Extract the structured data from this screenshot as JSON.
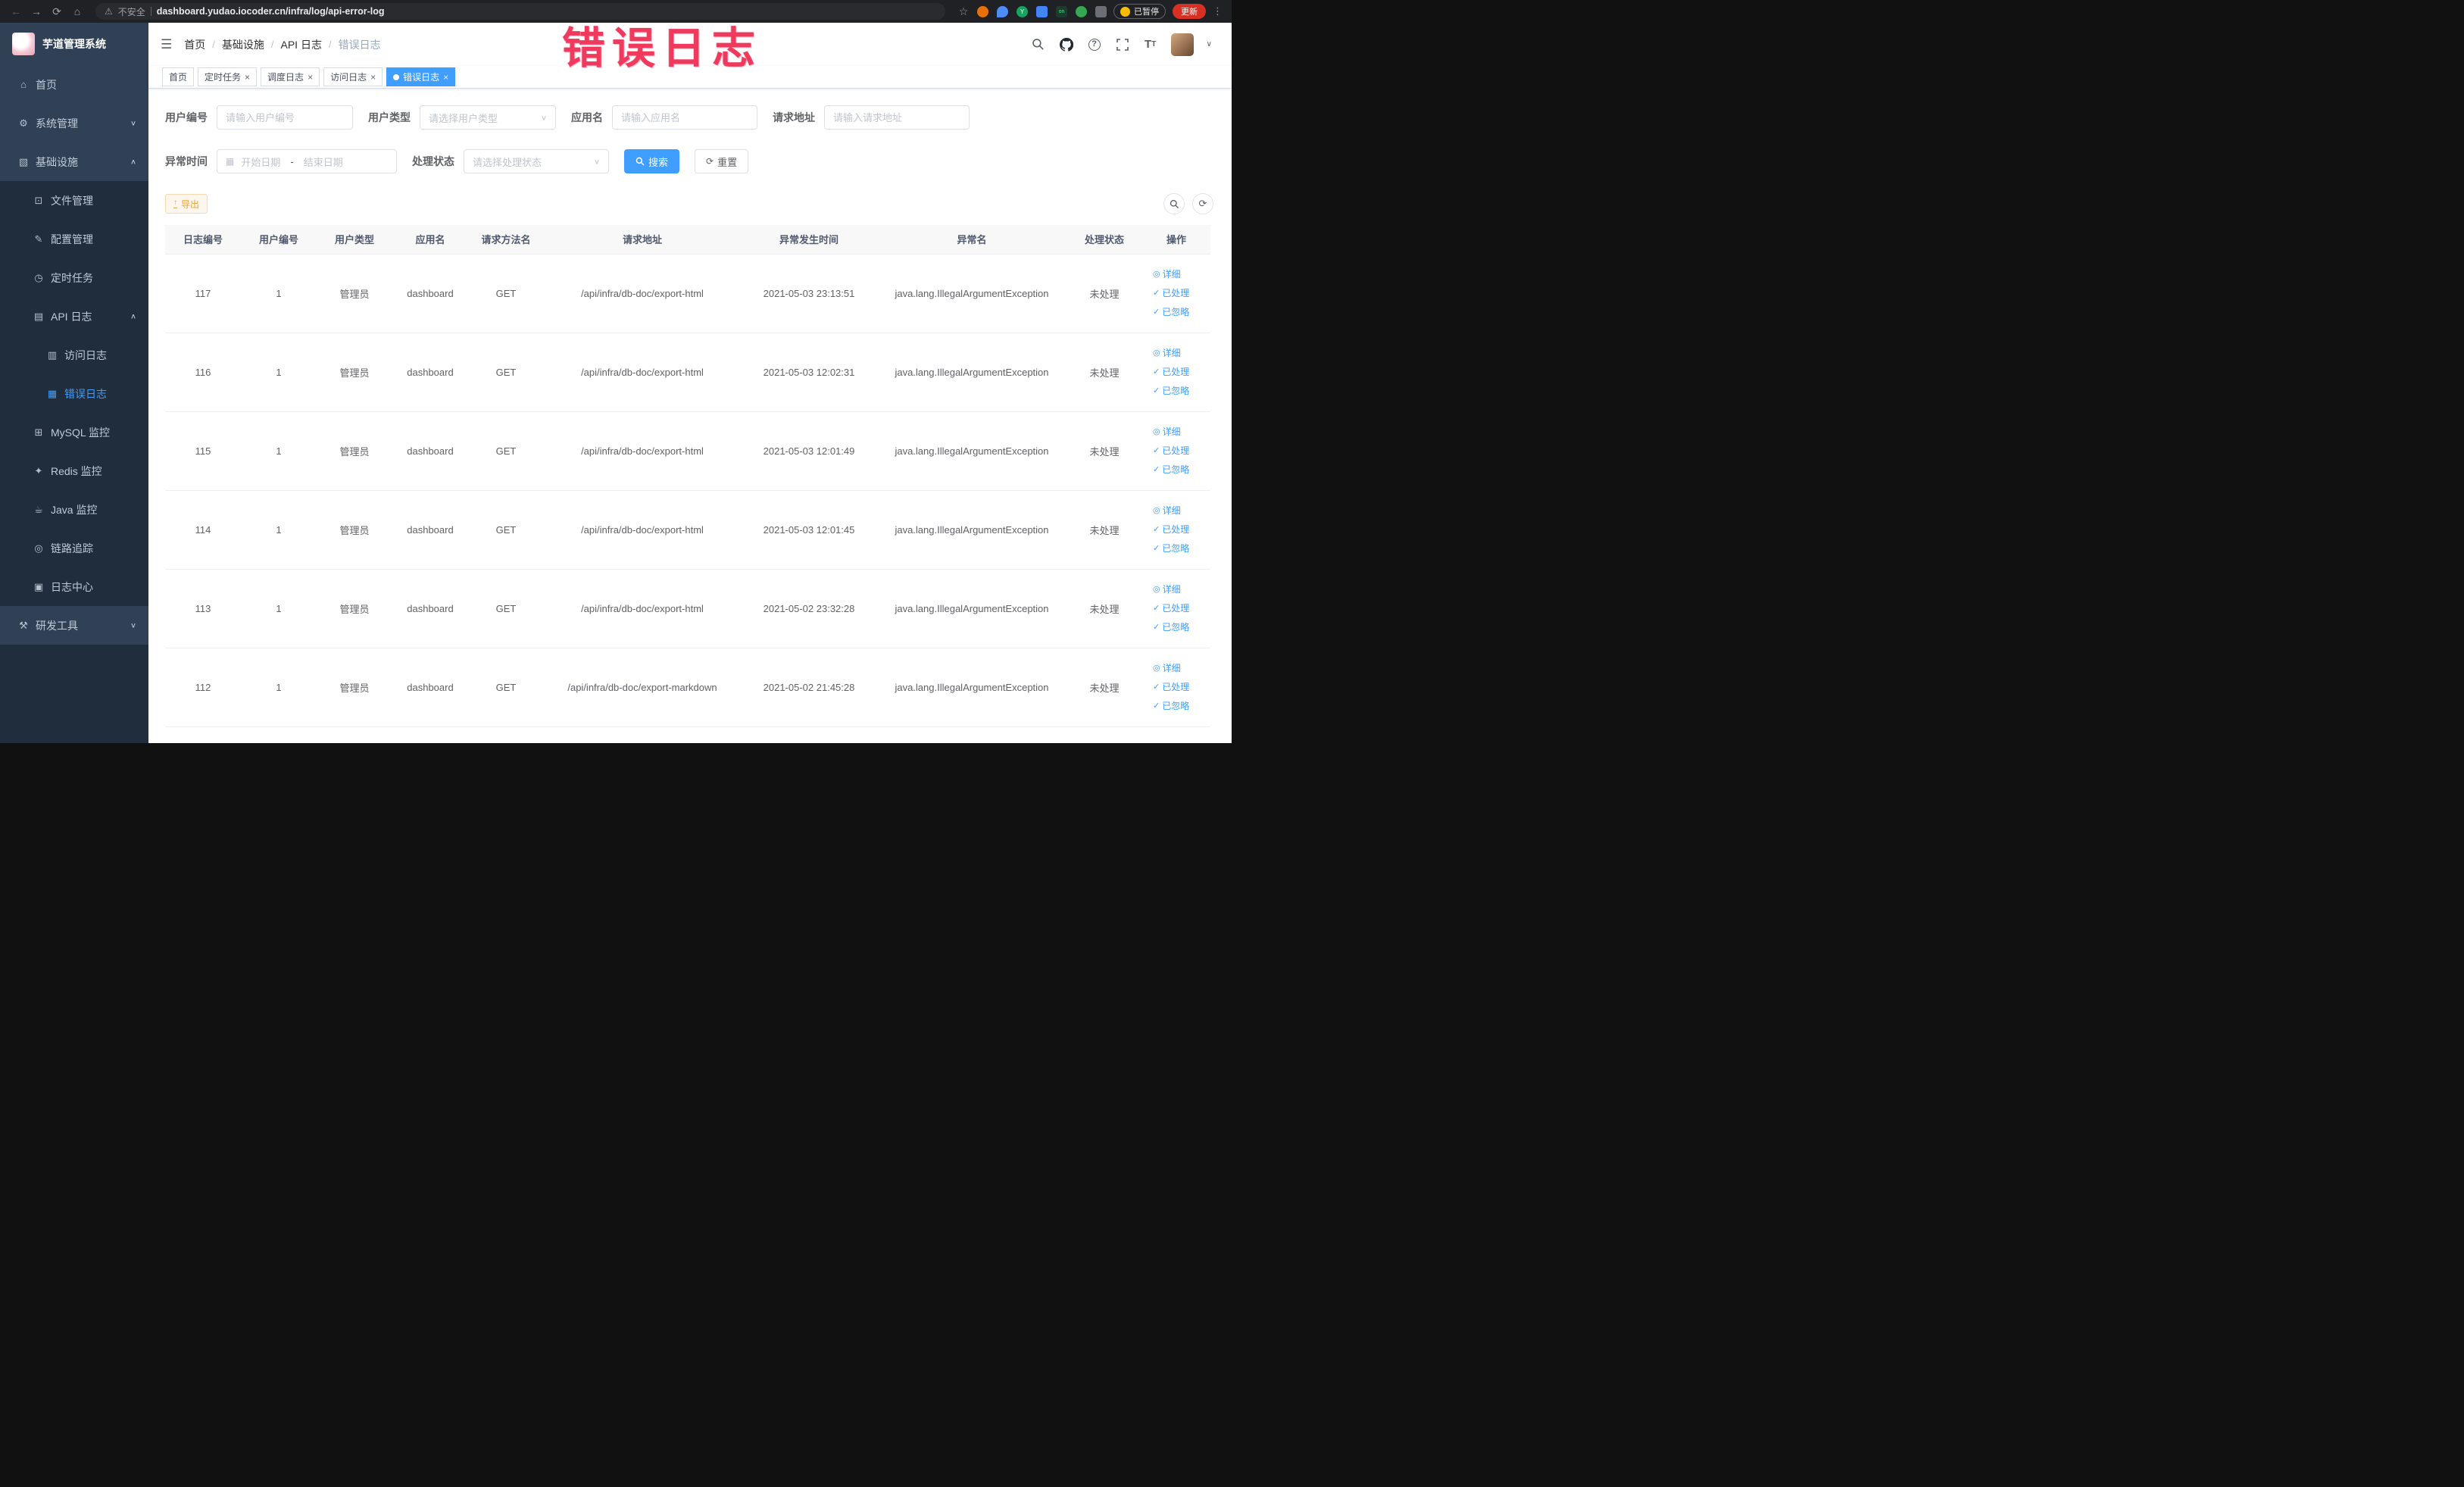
{
  "browser": {
    "security_label": "不安全",
    "url": "dashboard.yudao.iocoder.cn/infra/log/api-error-log",
    "paused_label": "已暂停",
    "update_label": "更新"
  },
  "annotation": {
    "text": "错误日志"
  },
  "sidebar": {
    "logo_title": "芋道管理系统",
    "items": [
      {
        "name": "home",
        "label": "首页",
        "icon": "home-icon",
        "level": 0
      },
      {
        "name": "system-mgmt",
        "label": "系统管理",
        "icon": "gear-icon",
        "level": 0,
        "arrow": "down"
      },
      {
        "name": "infrastructure",
        "label": "基础设施",
        "icon": "infra-icon",
        "level": 0,
        "arrow": "up"
      },
      {
        "name": "file-mgmt",
        "label": "文件管理",
        "icon": "file-icon",
        "level": 1
      },
      {
        "name": "config-mgmt",
        "label": "配置管理",
        "icon": "config-icon",
        "level": 1
      },
      {
        "name": "scheduled-tasks",
        "label": "定时任务",
        "icon": "timer-icon",
        "level": 1
      },
      {
        "name": "api-log",
        "label": "API 日志",
        "icon": "api-log-icon",
        "level": 1,
        "arrow": "up"
      },
      {
        "name": "access-log",
        "label": "访问日志",
        "icon": "access-log-icon",
        "level": 2
      },
      {
        "name": "error-log",
        "label": "错误日志",
        "icon": "error-log-icon",
        "level": 2,
        "active": true
      },
      {
        "name": "mysql-monitor",
        "label": "MySQL 监控",
        "icon": "mysql-icon",
        "level": 1
      },
      {
        "name": "redis-monitor",
        "label": "Redis 监控",
        "icon": "redis-icon",
        "level": 1
      },
      {
        "name": "java-monitor",
        "label": "Java 监控",
        "icon": "java-icon",
        "level": 1
      },
      {
        "name": "trace",
        "label": "链路追踪",
        "icon": "trace-icon",
        "level": 1
      },
      {
        "name": "log-center",
        "label": "日志中心",
        "icon": "log-center-icon",
        "level": 1
      },
      {
        "name": "dev-tools",
        "label": "研发工具",
        "icon": "tools-icon",
        "level": 0,
        "arrow": "down"
      }
    ]
  },
  "icon_glyphs": {
    "home-icon": "⌂",
    "gear-icon": "⚙",
    "infra-icon": "▧",
    "file-icon": "⊡",
    "config-icon": "✎",
    "timer-icon": "◷",
    "api-log-icon": "▤",
    "access-log-icon": "▥",
    "error-log-icon": "▦",
    "mysql-icon": "⊞",
    "redis-icon": "✦",
    "java-icon": "☕",
    "trace-icon": "◎",
    "log-center-icon": "▣",
    "tools-icon": "⚒",
    "eye-icon": "◎",
    "check-icon": "✓"
  },
  "header": {
    "breadcrumb": [
      "首页",
      "基础设施",
      "API 日志",
      "错误日志"
    ]
  },
  "tabs": [
    {
      "label": "首页",
      "closable": false,
      "active": false
    },
    {
      "label": "定时任务",
      "closable": true,
      "active": false
    },
    {
      "label": "调度日志",
      "closable": true,
      "active": false
    },
    {
      "label": "访问日志",
      "closable": true,
      "active": false
    },
    {
      "label": "错误日志",
      "closable": true,
      "active": true
    }
  ],
  "filters": {
    "user_id": {
      "label": "用户编号",
      "placeholder": "请输入用户编号"
    },
    "user_type": {
      "label": "用户类型",
      "placeholder": "请选择用户类型"
    },
    "app_name": {
      "label": "应用名",
      "placeholder": "请输入应用名"
    },
    "request_url": {
      "label": "请求地址",
      "placeholder": "请输入请求地址"
    },
    "exception_time": {
      "label": "异常时间",
      "start_placeholder": "开始日期",
      "separator": "-",
      "end_placeholder": "结束日期"
    },
    "process_status": {
      "label": "处理状态",
      "placeholder": "请选择处理状态"
    },
    "search_label": "搜索",
    "reset_label": "重置"
  },
  "toolbar": {
    "export_label": "导出"
  },
  "table": {
    "columns": [
      "日志编号",
      "用户编号",
      "用户类型",
      "应用名",
      "请求方法名",
      "请求地址",
      "异常发生时间",
      "异常名",
      "处理状态",
      "操作"
    ],
    "rows": [
      {
        "id": "117",
        "user_id": "1",
        "user_type": "管理员",
        "app_name": "dashboard",
        "method": "GET",
        "url": "/api/infra/db-doc/export-html",
        "time": "2021-05-03 23:13:51",
        "exception": "java.lang.IllegalArgumentException",
        "status": "未处理"
      },
      {
        "id": "116",
        "user_id": "1",
        "user_type": "管理员",
        "app_name": "dashboard",
        "method": "GET",
        "url": "/api/infra/db-doc/export-html",
        "time": "2021-05-03 12:02:31",
        "exception": "java.lang.IllegalArgumentException",
        "status": "未处理"
      },
      {
        "id": "115",
        "user_id": "1",
        "user_type": "管理员",
        "app_name": "dashboard",
        "method": "GET",
        "url": "/api/infra/db-doc/export-html",
        "time": "2021-05-03 12:01:49",
        "exception": "java.lang.IllegalArgumentException",
        "status": "未处理"
      },
      {
        "id": "114",
        "user_id": "1",
        "user_type": "管理员",
        "app_name": "dashboard",
        "method": "GET",
        "url": "/api/infra/db-doc/export-html",
        "time": "2021-05-03 12:01:45",
        "exception": "java.lang.IllegalArgumentException",
        "status": "未处理"
      },
      {
        "id": "113",
        "user_id": "1",
        "user_type": "管理员",
        "app_name": "dashboard",
        "method": "GET",
        "url": "/api/infra/db-doc/export-html",
        "time": "2021-05-02 23:32:28",
        "exception": "java.lang.IllegalArgumentException",
        "status": "未处理"
      },
      {
        "id": "112",
        "user_id": "1",
        "user_type": "管理员",
        "app_name": "dashboard",
        "method": "GET",
        "url": "/api/infra/db-doc/export-markdown",
        "time": "2021-05-02 21:45:28",
        "exception": "java.lang.IllegalArgumentException",
        "status": "未处理"
      }
    ],
    "actions": [
      {
        "name": "detail-link",
        "label": "详细",
        "icon": "eye-icon"
      },
      {
        "name": "mark-processed-link",
        "label": "已处理",
        "icon": "check-icon"
      },
      {
        "name": "mark-ignored-link",
        "label": "已忽略",
        "icon": "check-icon"
      }
    ]
  }
}
